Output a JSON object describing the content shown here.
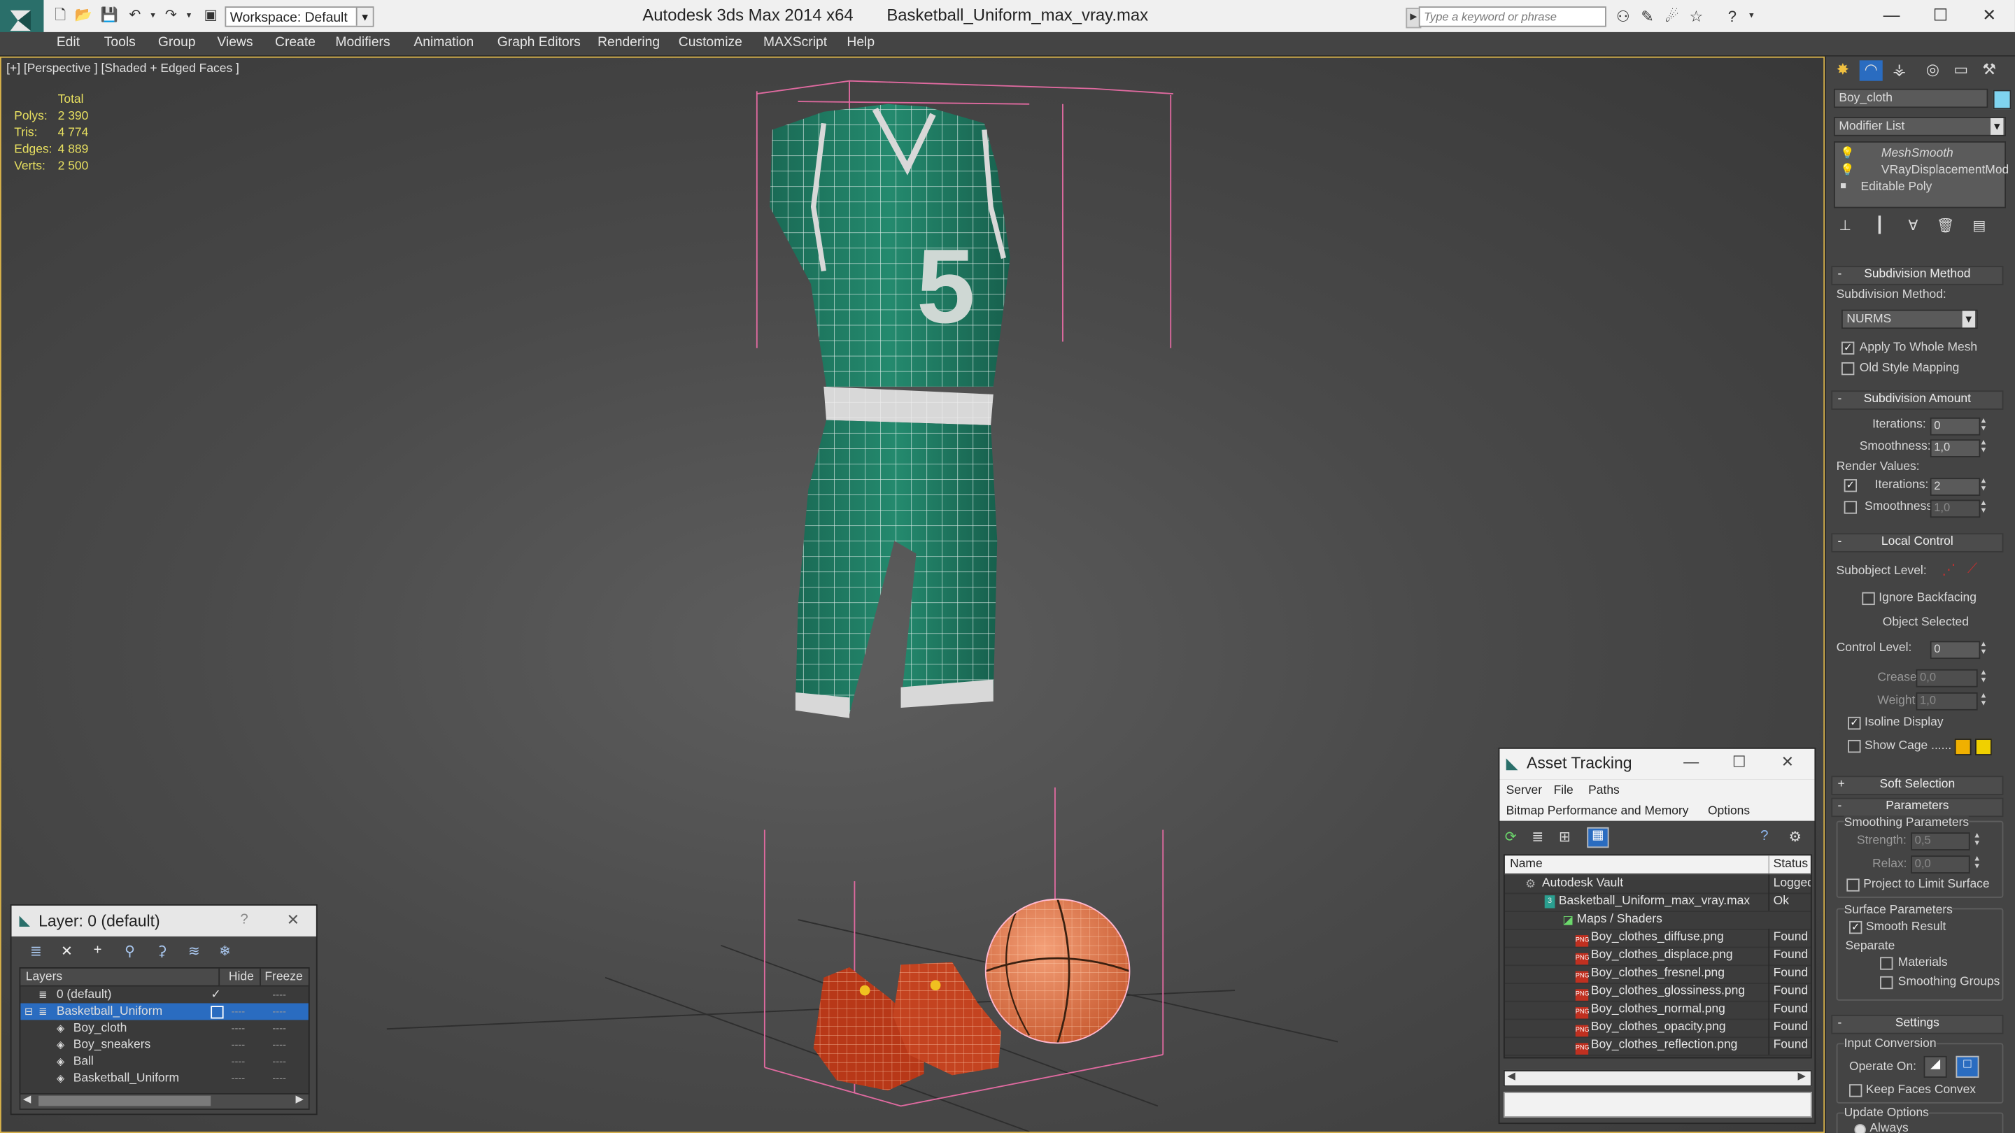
{
  "titlebar": {
    "app_title": "Autodesk 3ds Max  2014 x64",
    "file_title": "Basketball_Uniform_max_vray.max",
    "workspace": "Workspace: Default",
    "search_placeholder": "Type a keyword or phrase",
    "minimize": "—",
    "maximize": "☐",
    "close": "✕"
  },
  "menubar": [
    "Edit",
    "Tools",
    "Group",
    "Views",
    "Create",
    "Modifiers",
    "Animation",
    "Graph Editors",
    "Rendering",
    "Customize",
    "MAXScript",
    "Help"
  ],
  "viewport": {
    "label": "[+] [Perspective ] [Shaded + Edged Faces ]",
    "stats": {
      "header": "Total",
      "polys_label": "Polys:",
      "polys": "2 390",
      "tris_label": "Tris:",
      "tris": "4 774",
      "edges_label": "Edges:",
      "edges": "4 889",
      "verts_label": "Verts:",
      "verts": "2 500"
    },
    "jersey_number": "5"
  },
  "command_panel": {
    "object_name": "Boy_cloth",
    "object_color": "#7fd4f0",
    "modifier_list_label": "Modifier List",
    "stack": [
      "MeshSmooth",
      "VRayDisplacementMod",
      "Editable Poly"
    ],
    "subdivision_method": {
      "title": "Subdivision Method",
      "label": "Subdivision Method:",
      "value": "NURMS",
      "apply_whole": "Apply To Whole Mesh",
      "old_style": "Old Style Mapping"
    },
    "subdivision_amount": {
      "title": "Subdivision Amount",
      "iterations_label": "Iterations:",
      "iterations": "0",
      "smoothness_label": "Smoothness:",
      "smoothness": "1,0",
      "render_values": "Render Values:",
      "r_iterations_label": "Iterations:",
      "r_iterations": "2",
      "r_smoothness_label": "Smoothness:",
      "r_smoothness": "1,0"
    },
    "local_control": {
      "title": "Local Control",
      "subobject_label": "Subobject Level:",
      "ignore_backfacing": "Ignore Backfacing",
      "object_selected": "Object Selected",
      "control_level_label": "Control Level:",
      "control_level": "0",
      "crease_label": "Crease:",
      "crease": "0,0",
      "weight_label": "Weight:",
      "weight": "1,0",
      "isoline": "Isoline Display",
      "show_cage": "Show Cage ......",
      "cage_color_1": "#f0b000",
      "cage_color_2": "#f0d000"
    },
    "soft_selection": "Soft Selection",
    "parameters": {
      "title": "Parameters",
      "smoothing_group": "Smoothing Parameters",
      "strength_label": "Strength:",
      "strength": "0,5",
      "relax_label": "Relax:",
      "relax": "0,0",
      "project_limit": "Project to Limit Surface",
      "surface_group": "Surface Parameters",
      "smooth_result": "Smooth Result",
      "separate": "Separate",
      "materials": "Materials",
      "smoothing_groups": "Smoothing Groups"
    },
    "settings": {
      "title": "Settings",
      "input_conversion": "Input Conversion",
      "operate_on": "Operate On:",
      "keep_convex": "Keep Faces Convex",
      "update_options": "Update Options",
      "always": "Always"
    }
  },
  "layer_window": {
    "title": "Layer: 0 (default)",
    "help": "?",
    "close": "✕",
    "col_layers": "Layers",
    "col_hide": "Hide",
    "col_freeze": "Freeze",
    "rows": [
      {
        "name": "0 (default)",
        "hide": "",
        "freeze": "----"
      },
      {
        "name": "Basketball_Uniform",
        "hide": "----",
        "freeze": "----"
      },
      {
        "name": "Boy_cloth",
        "hide": "----",
        "freeze": "----"
      },
      {
        "name": "Boy_sneakers",
        "hide": "----",
        "freeze": "----"
      },
      {
        "name": "Ball",
        "hide": "----",
        "freeze": "----"
      },
      {
        "name": "Basketball_Uniform",
        "hide": "----",
        "freeze": "----"
      }
    ]
  },
  "asset_tracking": {
    "title": "Asset Tracking",
    "menu": [
      "Server",
      "File",
      "Paths"
    ],
    "menu2": [
      "Bitmap Performance and Memory",
      "Options"
    ],
    "col_name": "Name",
    "col_status": "Status",
    "rows": [
      {
        "name": "Autodesk Vault",
        "status": "Logged"
      },
      {
        "name": "Basketball_Uniform_max_vray.max",
        "status": "Ok"
      },
      {
        "name": "Maps / Shaders",
        "status": ""
      },
      {
        "name": "Boy_clothes_diffuse.png",
        "status": "Found"
      },
      {
        "name": "Boy_clothes_displace.png",
        "status": "Found"
      },
      {
        "name": "Boy_clothes_fresnel.png",
        "status": "Found"
      },
      {
        "name": "Boy_clothes_glossiness.png",
        "status": "Found"
      },
      {
        "name": "Boy_clothes_normal.png",
        "status": "Found"
      },
      {
        "name": "Boy_clothes_opacity.png",
        "status": "Found"
      },
      {
        "name": "Boy_clothes_reflection.png",
        "status": "Found"
      }
    ]
  },
  "colors": {
    "jersey": "#1f7a62",
    "wire": "#ffffff",
    "selection_box": "#e06aa0",
    "ball": "#e07850",
    "shoes": "#b83818",
    "accent": "#2a6cc0"
  }
}
